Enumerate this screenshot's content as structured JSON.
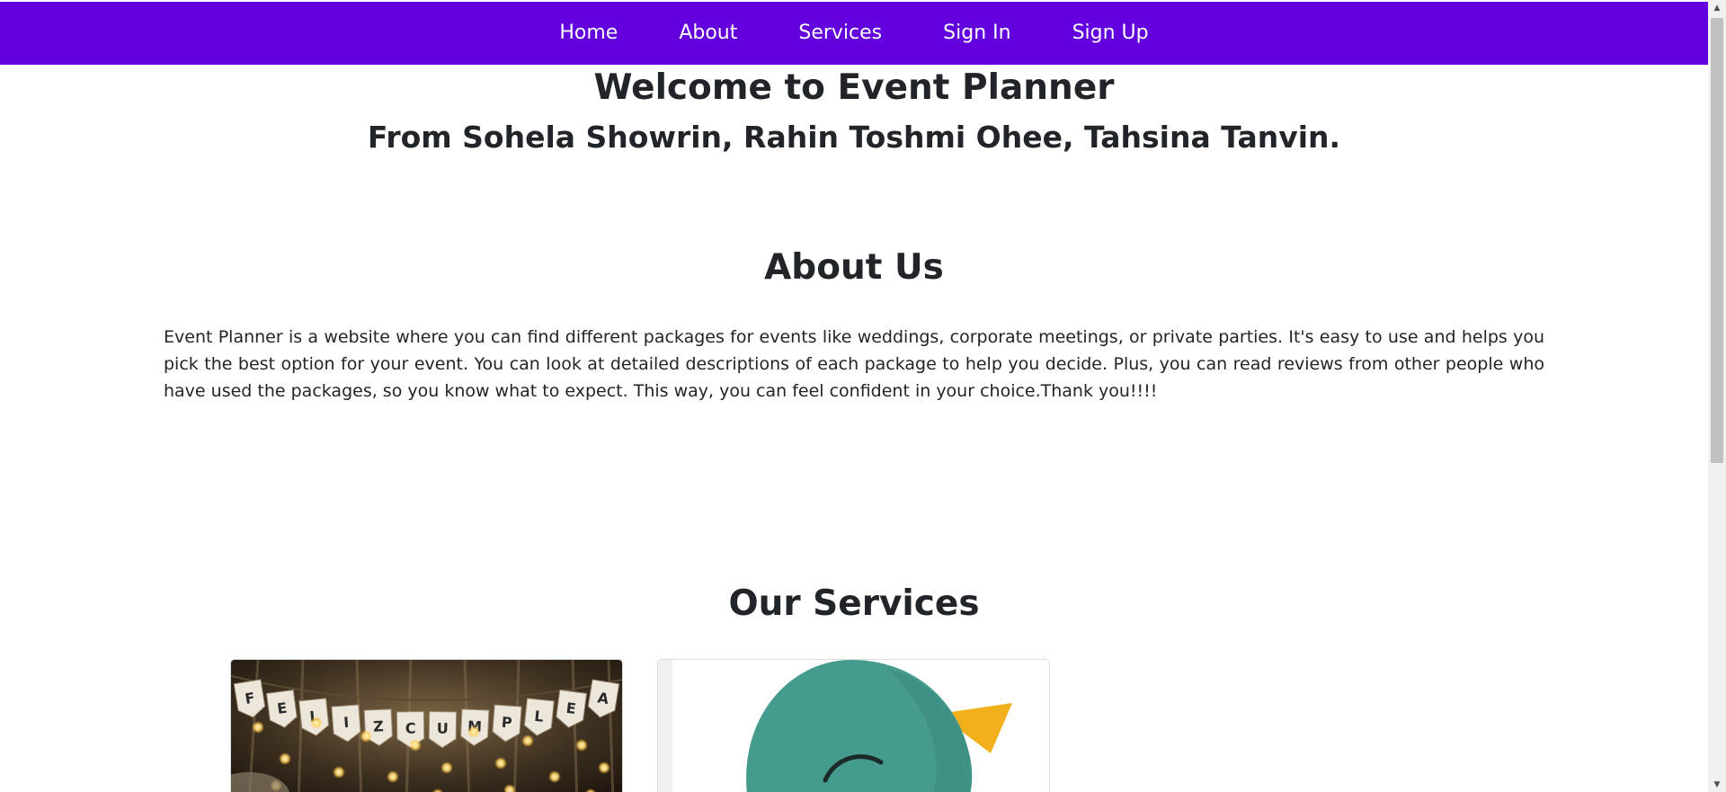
{
  "nav": {
    "items": [
      {
        "label": "Home"
      },
      {
        "label": "About"
      },
      {
        "label": "Services"
      },
      {
        "label": "Sign In"
      },
      {
        "label": "Sign Up"
      }
    ]
  },
  "hero": {
    "title": "Welcome to Event Planner",
    "subtitle": "From Sohela Showrin, Rahin Toshmi Ohee, Tahsina Tanvin."
  },
  "about": {
    "heading": "About Us",
    "text": "Event Planner is a website where you can find different packages for events like weddings, corporate meetings, or private parties. It's easy to use and helps you pick the best option for your event. You can look at detailed descriptions of each package to help you decide. Plus, you can read reviews from other people who have used the packages, so you know what to expect. This way, you can feel confident in your choice.Thank you!!!!"
  },
  "services": {
    "heading": "Our Services",
    "banner_letters": "F E L I Z C U M P L E A"
  },
  "colors": {
    "nav_background": "#6200de",
    "nav_text": "#ffffff",
    "body_text": "#212529",
    "bird_teal": "#459c8e",
    "bird_beak": "#f2b11c"
  }
}
